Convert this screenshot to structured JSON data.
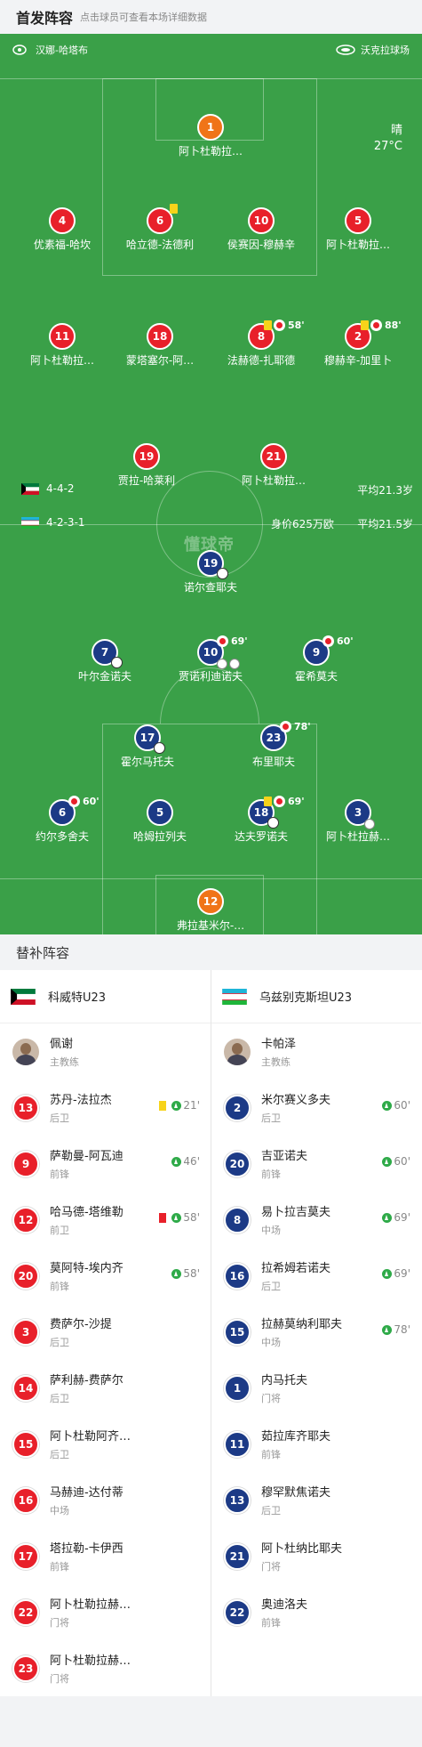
{
  "header": {
    "title": "首发阵容",
    "subtitle": "点击球员可查看本场详细数据"
  },
  "pitch": {
    "home_team": "汉娜-哈塔布",
    "away_team": "沃克拉球场",
    "weather": "晴",
    "temperature": "27°C",
    "watermark": "懂球帝",
    "home_formation": "4-4-2",
    "home_avg_age": "平均21.3岁",
    "away_formation": "4-2-3-1",
    "away_value": "身价625万欧",
    "away_avg_age": "平均21.5岁",
    "home_players": [
      {
        "num": "1",
        "name": "阿卜杜勒拉…",
        "color": "gk"
      },
      {
        "num": "4",
        "name": "优素福-哈坎",
        "color": "red"
      },
      {
        "num": "6",
        "name": "哈立德-法德利",
        "color": "red",
        "yellow": true
      },
      {
        "num": "10",
        "name": "侯赛因-穆赫辛",
        "color": "red"
      },
      {
        "num": "5",
        "name": "阿卜杜勒拉…",
        "color": "red"
      },
      {
        "num": "11",
        "name": "阿卜杜勒拉…",
        "color": "red"
      },
      {
        "num": "18",
        "name": "蒙塔塞尔-阿…",
        "color": "red"
      },
      {
        "num": "8",
        "name": "法赫德-扎耶德",
        "color": "red",
        "yellow": true,
        "sub": "58'"
      },
      {
        "num": "2",
        "name": "穆赫辛-加里卜",
        "color": "red",
        "yellow": true,
        "sub": "88'"
      },
      {
        "num": "19",
        "name": "贾拉-哈莱利",
        "color": "red"
      },
      {
        "num": "21",
        "name": "阿卜杜勒拉…",
        "color": "red"
      }
    ],
    "away_players": [
      {
        "num": "19",
        "name": "诺尔查耶夫",
        "color": "blue",
        "goal": true
      },
      {
        "num": "7",
        "name": "叶尔金诺夫",
        "color": "blue",
        "goal": true
      },
      {
        "num": "10",
        "name": "贾诺利迪诺夫",
        "color": "blue",
        "sub": "69'",
        "assist": true
      },
      {
        "num": "9",
        "name": "霍希莫夫",
        "color": "blue",
        "sub": "60'"
      },
      {
        "num": "17",
        "name": "霍尔马托夫",
        "color": "blue",
        "goal": true
      },
      {
        "num": "23",
        "name": "布里耶夫",
        "color": "blue",
        "sub": "78'"
      },
      {
        "num": "6",
        "name": "约尔多舍夫",
        "color": "blue",
        "sub": "60'"
      },
      {
        "num": "5",
        "name": "哈姆拉列夫",
        "color": "blue"
      },
      {
        "num": "18",
        "name": "达夫罗诺夫",
        "color": "blue",
        "yellow": true,
        "sub": "69'",
        "goal": true
      },
      {
        "num": "3",
        "name": "阿卜杜拉赫…",
        "color": "blue",
        "assist": true
      },
      {
        "num": "12",
        "name": "弗拉基米尔-…",
        "color": "gk"
      }
    ]
  },
  "subs": {
    "title": "替补阵容",
    "home": {
      "team": "科威特U23",
      "coach": {
        "name": "佩谢",
        "role": "主教练"
      },
      "players": [
        {
          "num": "13",
          "name": "苏丹-法拉杰",
          "pos": "后卫",
          "card": "yellow",
          "time": "21'"
        },
        {
          "num": "9",
          "name": "萨勒曼-阿瓦迪",
          "pos": "前锋",
          "time": "46'"
        },
        {
          "num": "12",
          "name": "哈马德-塔维勒",
          "pos": "前卫",
          "card": "red",
          "time": "58'"
        },
        {
          "num": "20",
          "name": "莫阿特-埃内齐",
          "pos": "前锋",
          "time": "58'"
        },
        {
          "num": "3",
          "name": "费萨尔-沙提",
          "pos": "后卫"
        },
        {
          "num": "14",
          "name": "萨利赫-费萨尔",
          "pos": "后卫"
        },
        {
          "num": "15",
          "name": "阿卜杜勒阿齐…",
          "pos": "后卫"
        },
        {
          "num": "16",
          "name": "马赫迪-达付蒂",
          "pos": "中场"
        },
        {
          "num": "17",
          "name": "塔拉勒-卡伊西",
          "pos": "前锋"
        },
        {
          "num": "22",
          "name": "阿卜杜勒拉赫…",
          "pos": "门将"
        },
        {
          "num": "23",
          "name": "阿卜杜勒拉赫…",
          "pos": "门将"
        }
      ]
    },
    "away": {
      "team": "乌兹别克斯坦U23",
      "coach": {
        "name": "卡帕泽",
        "role": "主教练"
      },
      "players": [
        {
          "num": "2",
          "name": "米尔赛义多夫",
          "pos": "后卫",
          "time": "60'"
        },
        {
          "num": "20",
          "name": "吉亚诺夫",
          "pos": "前锋",
          "time": "60'"
        },
        {
          "num": "8",
          "name": "易卜拉吉莫夫",
          "pos": "中场",
          "time": "69'"
        },
        {
          "num": "16",
          "name": "拉希姆若诺夫",
          "pos": "后卫",
          "time": "69'"
        },
        {
          "num": "15",
          "name": "拉赫莫纳利耶夫",
          "pos": "中场",
          "time": "78'"
        },
        {
          "num": "1",
          "name": "内马托夫",
          "pos": "门将"
        },
        {
          "num": "11",
          "name": "茹拉库齐耶夫",
          "pos": "前锋"
        },
        {
          "num": "13",
          "name": "穆罕默焦诺夫",
          "pos": "后卫"
        },
        {
          "num": "21",
          "name": "阿卜杜纳比耶夫",
          "pos": "门将"
        },
        {
          "num": "22",
          "name": "奥迪洛夫",
          "pos": "前锋"
        }
      ]
    }
  }
}
